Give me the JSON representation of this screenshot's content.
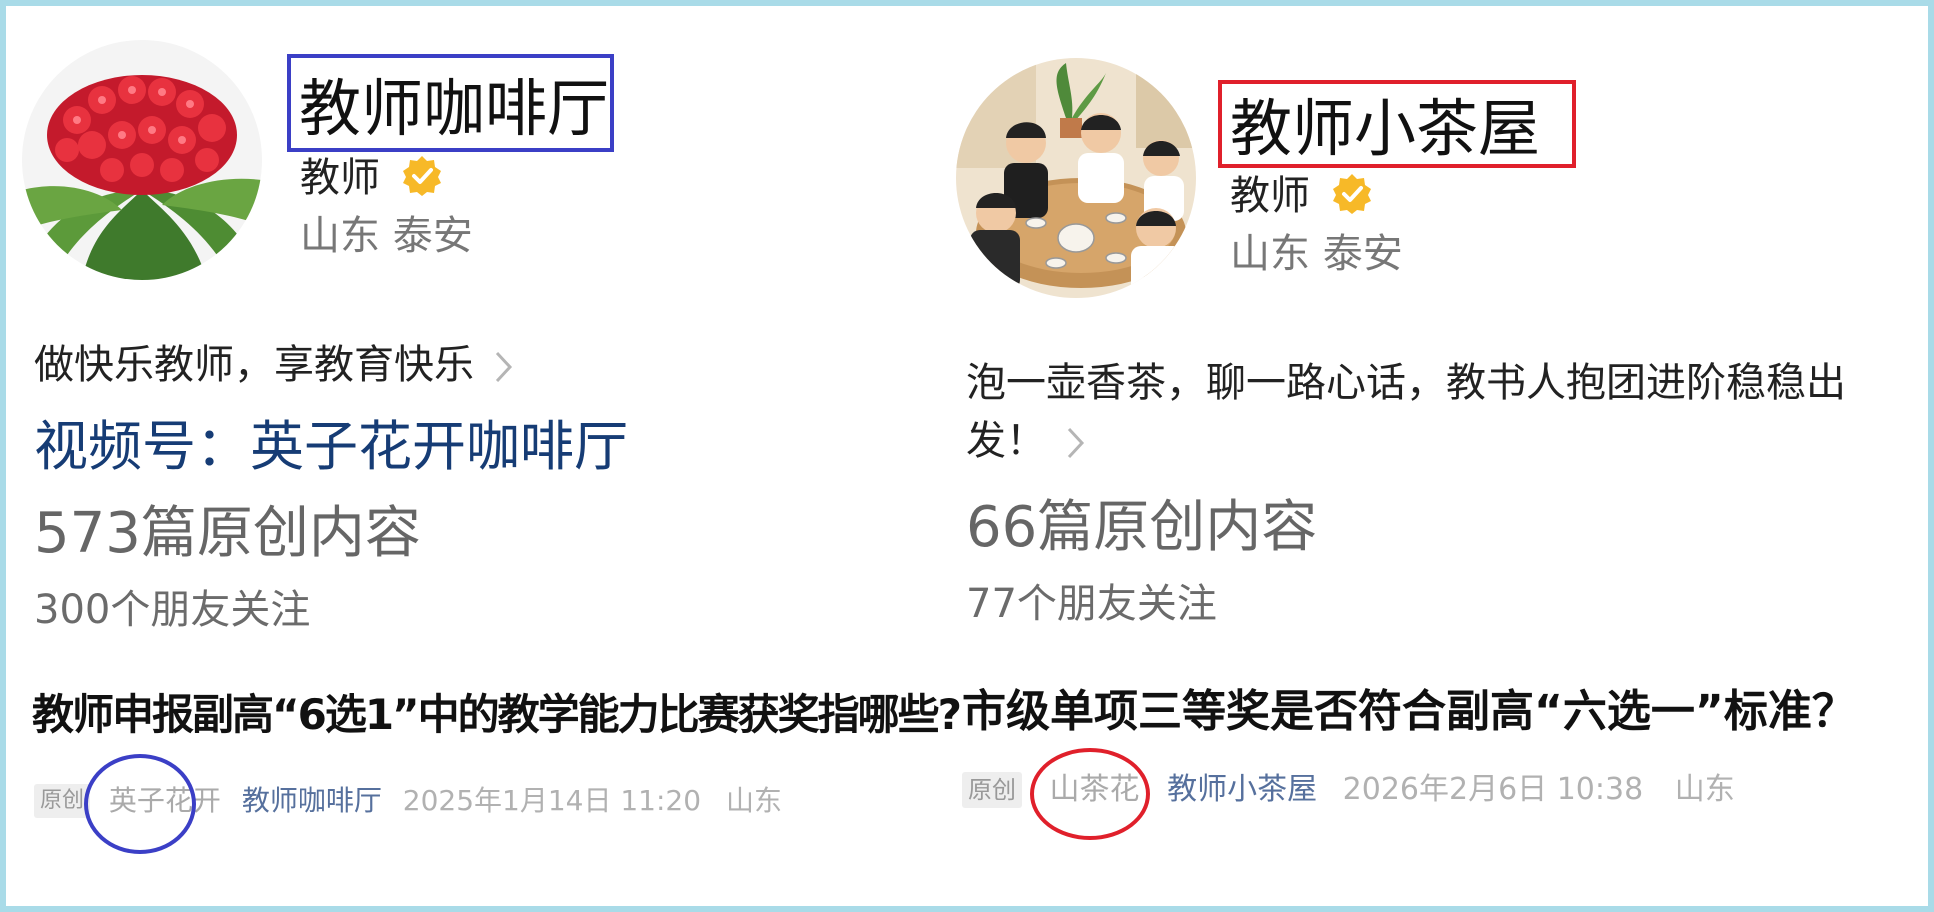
{
  "colors": {
    "frame_border": "#a9dbe8",
    "highlight_blue": "#3b3fc6",
    "highlight_red": "#e0202b",
    "verified_gold": "#f7b928",
    "link_blue": "#163c75",
    "account_blue": "#56709d"
  },
  "left": {
    "avatar_icon": "red-flower-photo",
    "name": "教师咖啡厅",
    "role": "教师",
    "verified_icon": "verified-badge-icon",
    "location": "山东 泰安",
    "bio": "做快乐教师，享教育快乐",
    "video_channel": "视频号：英子花开咖啡厅",
    "original_count": "573篇原创内容",
    "friends_following": "300个朋友关注",
    "article": {
      "title": "教师申报副高“6选1”中的教学能力比赛获奖指哪些?",
      "badge": "原创",
      "author": "英子花开",
      "account": "教师咖啡厅",
      "date": "2025年1月14日 11:20",
      "region": "山东"
    }
  },
  "right": {
    "avatar_icon": "teachers-tea-illustration",
    "name": "教师小茶屋",
    "role": "教师",
    "verified_icon": "verified-badge-icon",
    "location": "山东 泰安",
    "bio": "泡一壶香茶，聊一路心话，教书人抱团进阶稳稳出发！",
    "original_count": "66篇原创内容",
    "friends_following": "77个朋友关注",
    "article": {
      "title": "市级单项三等奖是否符合副高“六选一”标准？",
      "badge": "原创",
      "author": "山茶花",
      "account": "教师小茶屋",
      "date": "2026年2月6日 10:38",
      "region": "山东"
    }
  }
}
